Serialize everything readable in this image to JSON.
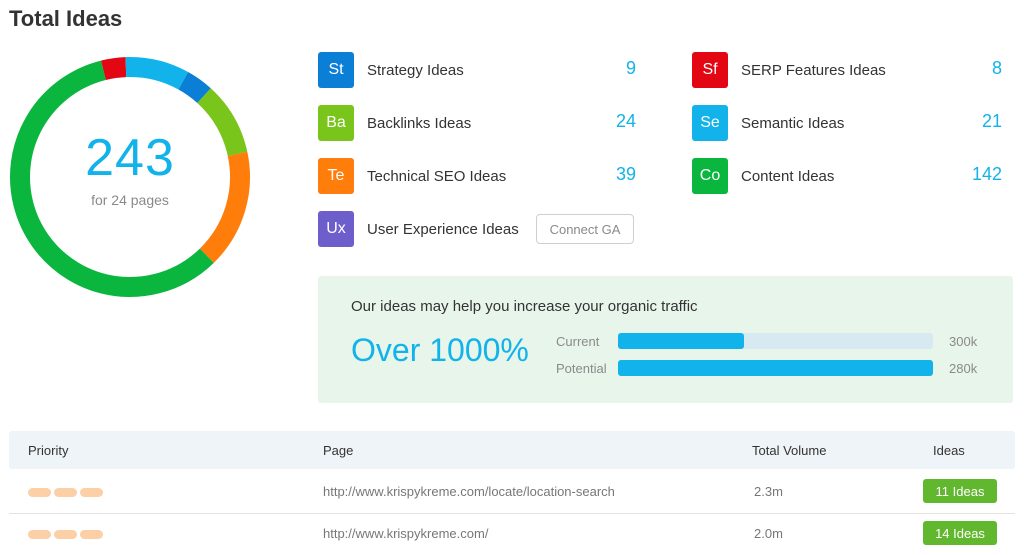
{
  "page_title": "Total Ideas",
  "summary": {
    "total": "243",
    "subtitle": "for 24 pages"
  },
  "chart_data": {
    "type": "pie",
    "title": "",
    "categories": [
      "SERP Features Ideas",
      "Semantic Ideas",
      "Strategy Ideas",
      "Backlinks Ideas",
      "Technical SEO Ideas",
      "Content Ideas"
    ],
    "values": [
      8,
      21,
      9,
      24,
      39,
      142
    ],
    "colors": [
      "#e30613",
      "#11b3ea",
      "#0b7ed6",
      "#7ac51b",
      "#ff7d0b",
      "#0ab63e"
    ],
    "style": "donut"
  },
  "ideas": [
    {
      "abbr": "St",
      "label": "Strategy Ideas",
      "count": "9",
      "color": "#0b7ed6"
    },
    {
      "abbr": "Ba",
      "label": "Backlinks Ideas",
      "count": "24",
      "color": "#7ac51b"
    },
    {
      "abbr": "Te",
      "label": "Technical SEO Ideas",
      "count": "39",
      "color": "#ff7d0b"
    },
    {
      "abbr": "Ux",
      "label": "User Experience Ideas",
      "count": "",
      "color": "#6c5fcc"
    },
    {
      "abbr": "Sf",
      "label": "SERP Features Ideas",
      "count": "8",
      "color": "#e30613"
    },
    {
      "abbr": "Se",
      "label": "Semantic Ideas",
      "count": "21",
      "color": "#11b3ea"
    },
    {
      "abbr": "Co",
      "label": "Content Ideas",
      "count": "142",
      "color": "#0ab63e"
    }
  ],
  "connect_ga_label": "Connect GA",
  "traffic": {
    "heading": "Our ideas may help you increase your organic traffic",
    "headline": "Over 1000%",
    "current_label": "Current",
    "current_value": "300k",
    "current_fill": 0.4,
    "potential_label": "Potential",
    "potential_value": "280k",
    "potential_fill": 1.0
  },
  "table": {
    "headers": {
      "priority": "Priority",
      "page": "Page",
      "volume": "Total Volume",
      "ideas": "Ideas"
    },
    "rows": [
      {
        "page": "http://www.krispykreme.com/locate/location-search",
        "volume": "2.3m",
        "ideas": "11 Ideas",
        "priority_level": 3
      },
      {
        "page": "http://www.krispykreme.com/",
        "volume": "2.0m",
        "ideas": "14 Ideas",
        "priority_level": 3
      }
    ]
  }
}
